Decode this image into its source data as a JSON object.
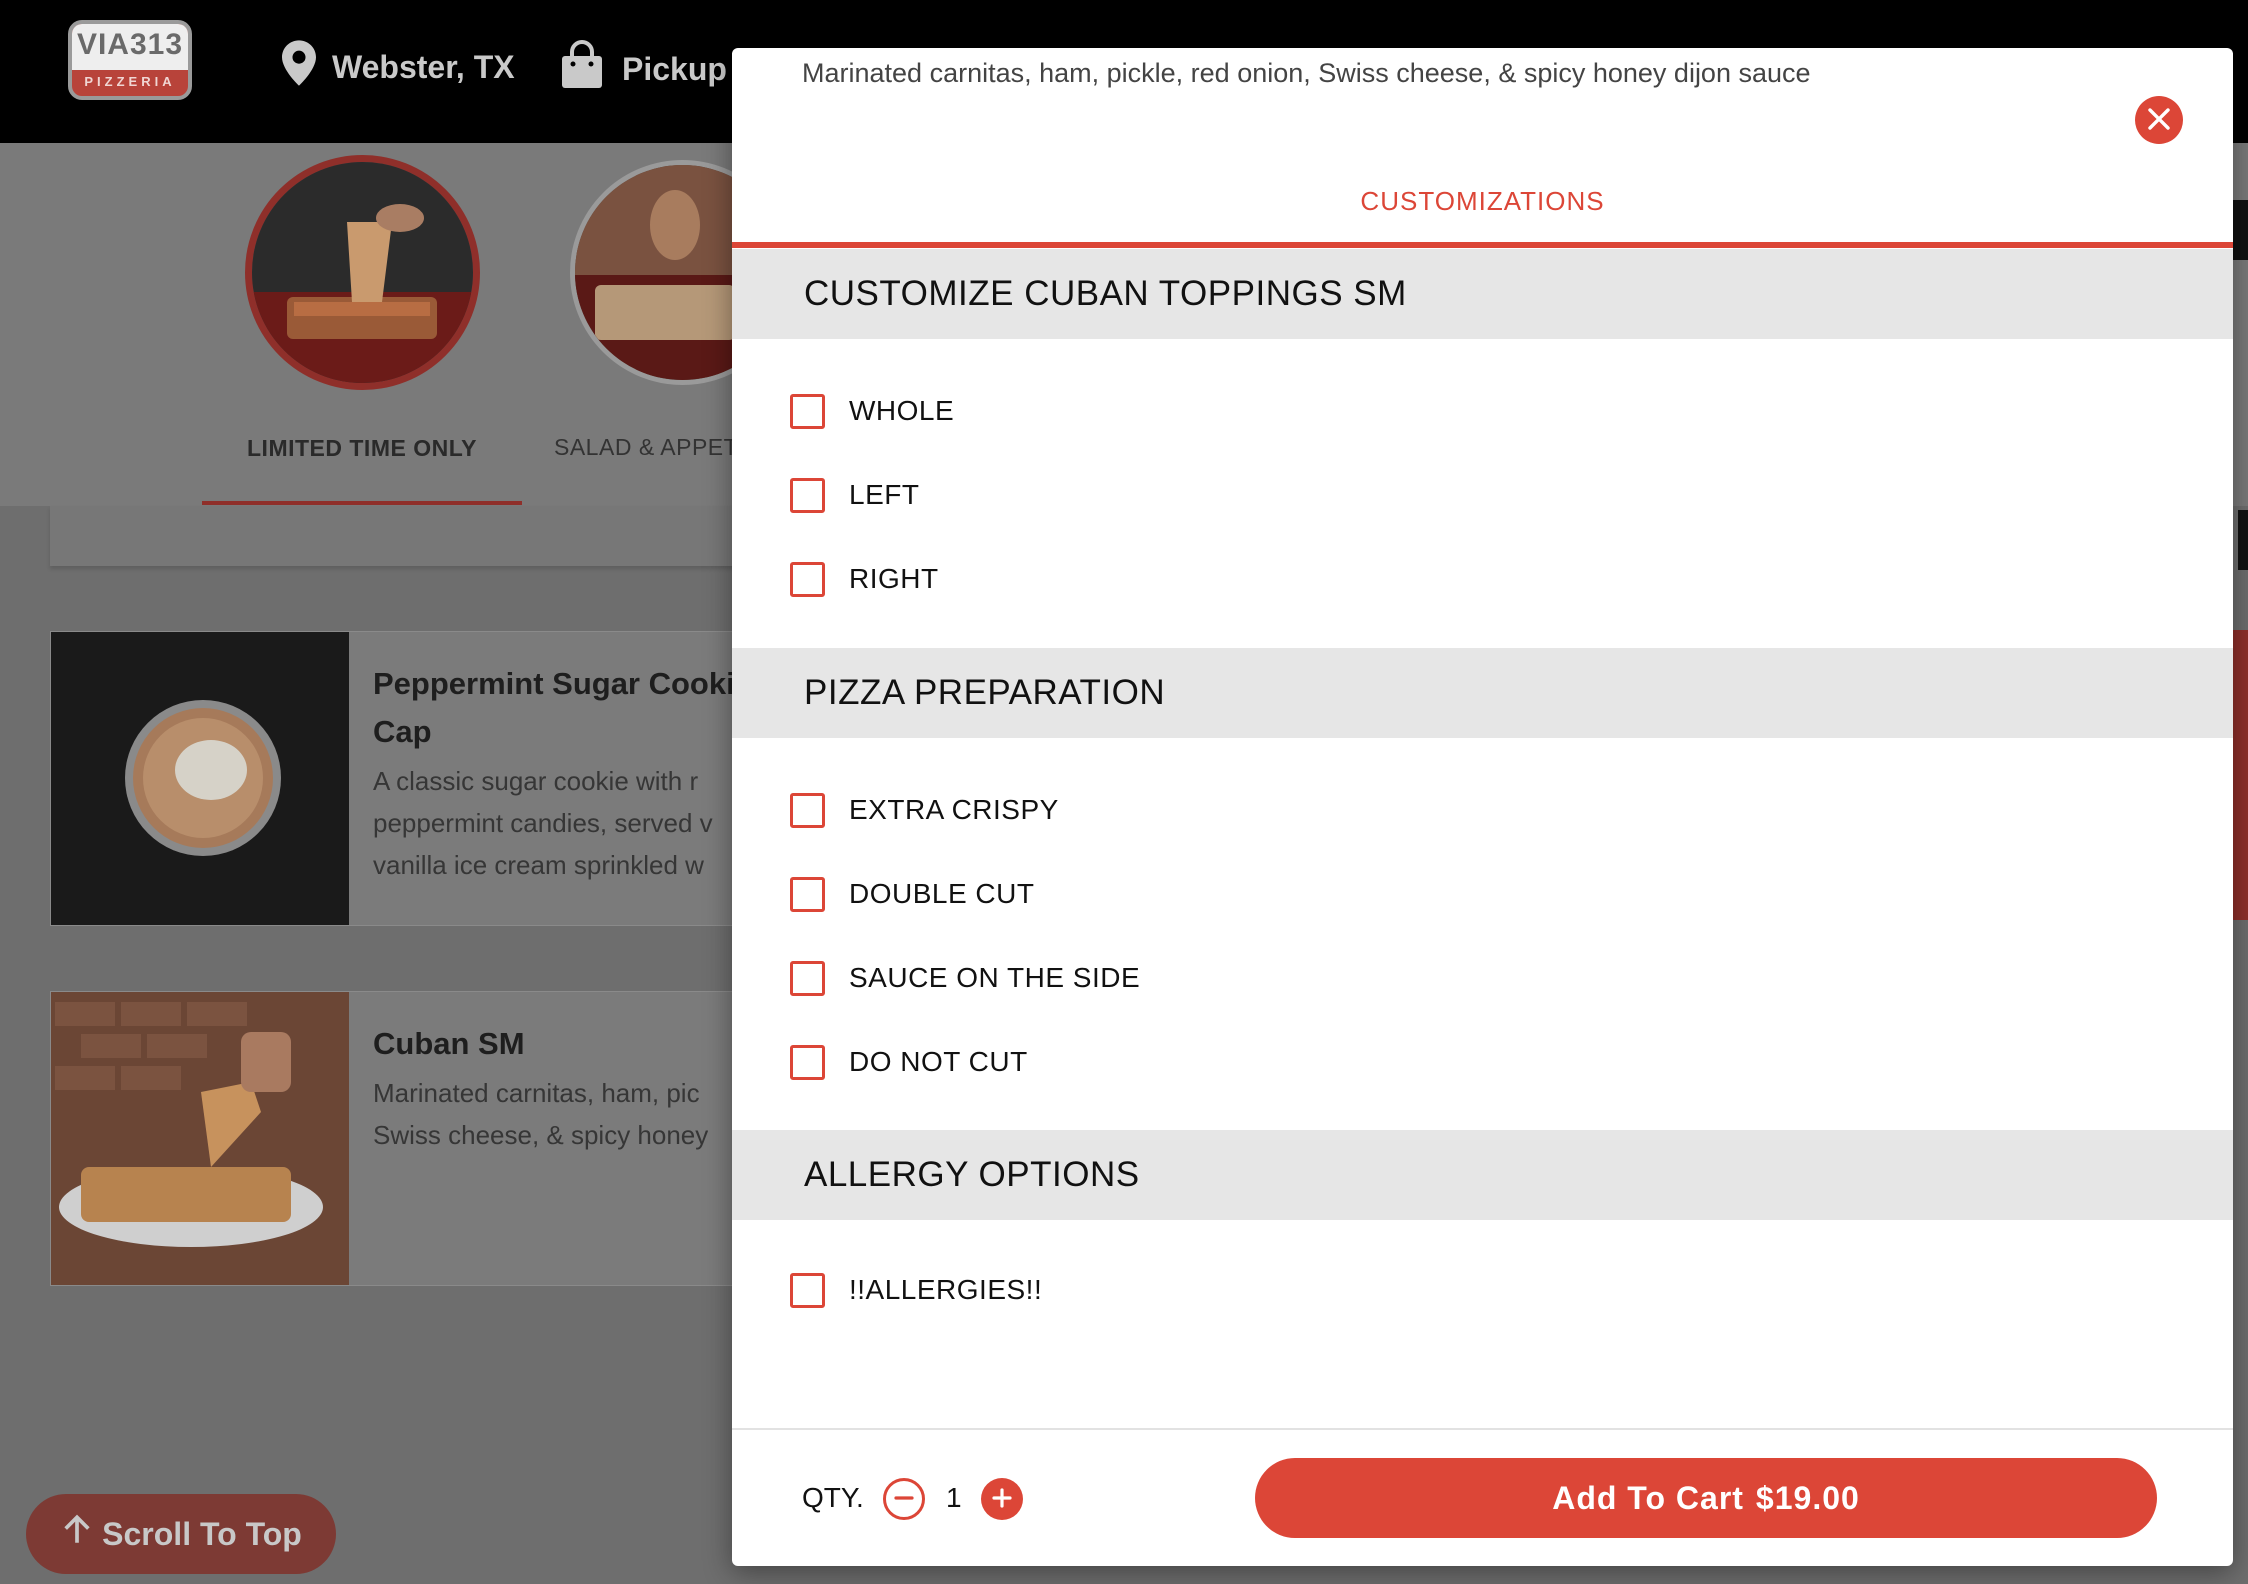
{
  "header": {
    "logo_text": "VIA313",
    "logo_sub": "PIZZERIA",
    "location": "Webster, TX",
    "order_type": "Pickup"
  },
  "categories": [
    {
      "label": "LIMITED TIME ONLY"
    },
    {
      "label": "SALAD & APPET"
    }
  ],
  "menu_items": [
    {
      "title_line1": "Peppermint Sugar Cooki",
      "title_line2": "Cap",
      "desc_lines": [
        "A classic sugar cookie with r",
        "peppermint candies, served v",
        "vanilla ice cream sprinkled w"
      ]
    },
    {
      "title_line1": "Cuban SM",
      "desc_lines": [
        "Marinated carnitas, ham, pic",
        "Swiss cheese, & spicy honey"
      ]
    }
  ],
  "scroll_top_label": "Scroll To Top",
  "modal": {
    "description": "Marinated carnitas, ham, pickle, red onion, Swiss cheese, & spicy honey dijon sauce",
    "tab": "CUSTOMIZATIONS",
    "sections": [
      {
        "title": "CUSTOMIZE CUBAN TOPPINGS SM",
        "options": [
          "WHOLE",
          "LEFT",
          "RIGHT"
        ]
      },
      {
        "title": "PIZZA PREPARATION",
        "options": [
          "EXTRA CRISPY",
          "DOUBLE CUT",
          "SAUCE ON THE SIDE",
          "DO NOT CUT"
        ]
      },
      {
        "title": "ALLERGY OPTIONS",
        "options": [
          "!!ALLERGIES!!"
        ]
      }
    ],
    "qty_label": "QTY.",
    "qty_value": "1",
    "add_to_cart_label": "Add To Cart",
    "price": "$19.00"
  },
  "colors": {
    "accent": "#dc4637",
    "header_bg": "#000000",
    "section_bg": "#e6e6e6"
  }
}
